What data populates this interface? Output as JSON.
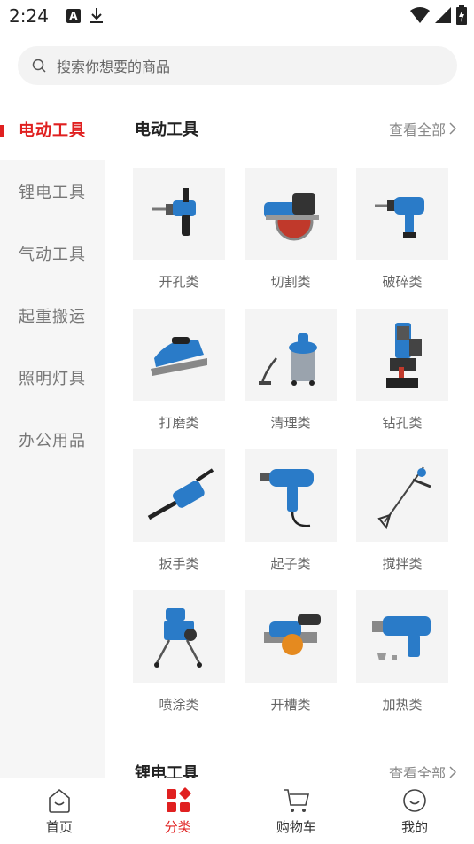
{
  "status_bar": {
    "time": "2:24",
    "notif_icon": "A"
  },
  "search": {
    "placeholder": "搜索你想要的商品"
  },
  "sidebar": {
    "items": [
      {
        "label": "电动工具",
        "active": true
      },
      {
        "label": "锂电工具",
        "active": false
      },
      {
        "label": "气动工具",
        "active": false
      },
      {
        "label": "起重搬运",
        "active": false
      },
      {
        "label": "照明灯具",
        "active": false
      },
      {
        "label": "办公用品",
        "active": false
      }
    ]
  },
  "sections": [
    {
      "title": "电动工具",
      "view_all": "查看全部",
      "items": [
        {
          "label": "开孔类",
          "icon": "drill-icon"
        },
        {
          "label": "切割类",
          "icon": "circular-saw-icon"
        },
        {
          "label": "破碎类",
          "icon": "impact-drill-icon"
        },
        {
          "label": "打磨类",
          "icon": "planer-icon"
        },
        {
          "label": "清理类",
          "icon": "vacuum-icon"
        },
        {
          "label": "钻孔类",
          "icon": "magnetic-drill-icon"
        },
        {
          "label": "扳手类",
          "icon": "wrench-tool-icon"
        },
        {
          "label": "起子类",
          "icon": "screwdriver-tool-icon"
        },
        {
          "label": "搅拌类",
          "icon": "mixer-icon"
        },
        {
          "label": "喷涂类",
          "icon": "sprayer-icon"
        },
        {
          "label": "开槽类",
          "icon": "grooving-icon"
        },
        {
          "label": "加热类",
          "icon": "heat-gun-icon"
        }
      ]
    },
    {
      "title": "锂电工具",
      "view_all": "查看全部"
    }
  ],
  "bottom_nav": [
    {
      "label": "首页",
      "active": false
    },
    {
      "label": "分类",
      "active": true
    },
    {
      "label": "购物车",
      "active": false
    },
    {
      "label": "我的",
      "active": false
    }
  ],
  "colors": {
    "accent": "#e02020",
    "tool_blue": "#2a7bc8"
  }
}
